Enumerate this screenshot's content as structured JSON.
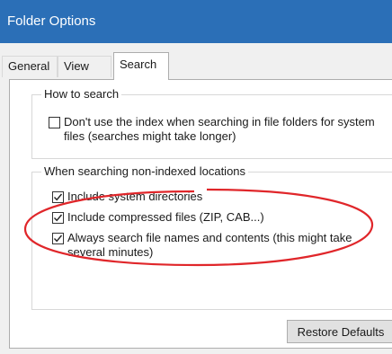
{
  "window": {
    "title": "Folder Options"
  },
  "tabs": [
    {
      "label": "General",
      "active": false
    },
    {
      "label": "View",
      "active": false
    },
    {
      "label": "Search",
      "active": true
    }
  ],
  "how_to_search": {
    "title": "How to search",
    "options": [
      {
        "label": "Don't use the index when searching in file folders for system files (searches might take longer)",
        "checked": false
      }
    ]
  },
  "non_indexed": {
    "title": "When searching non-indexed locations",
    "options": [
      {
        "label": "Include system directories",
        "checked": true
      },
      {
        "label": "Include compressed files (ZIP, CAB...)",
        "checked": true
      },
      {
        "label": "Always search file names and contents (this might take several minutes)",
        "checked": true
      }
    ]
  },
  "buttons": {
    "restore_defaults": "Restore Defaults"
  },
  "colors": {
    "titlebar": "#2b6fb7",
    "annotation_circle": "#e0262a",
    "checkmark": "#222222"
  }
}
